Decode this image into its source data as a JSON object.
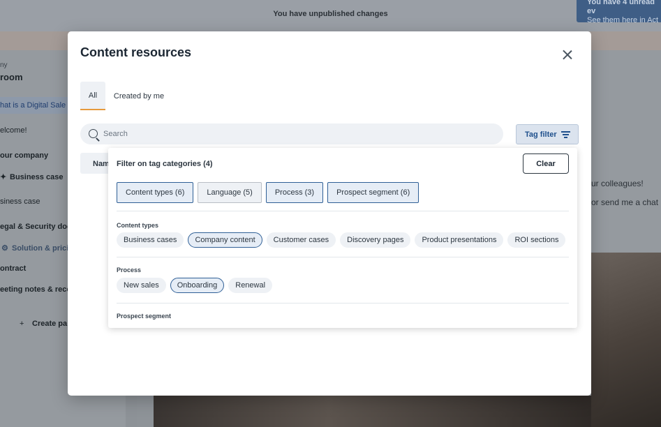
{
  "background": {
    "banner_text": "You have unpublished changes",
    "notification": {
      "line1": "You have 4 unread ev",
      "line2": "See them here in Act"
    },
    "sidebar": {
      "company": "ny",
      "room": "room",
      "items": [
        "hat is a Digital Sale",
        "elcome!",
        "our company",
        "Business case",
        "siness case",
        "egal & Security doc",
        "Solution & pricin",
        "ontract",
        "eeting notes & reco",
        "Create pa"
      ]
    },
    "right_panel": {
      "line1": "ur colleagues!",
      "line2": "or send me a chat"
    }
  },
  "modal": {
    "title": "Content resources",
    "tabs": [
      {
        "label": "All",
        "active": true
      },
      {
        "label": "Created by me",
        "active": false
      }
    ],
    "search": {
      "placeholder": "Search",
      "value": ""
    },
    "tag_filter_label": "Tag filter",
    "name_column_label": "Nam"
  },
  "dropdown": {
    "title": "Filter on tag categories (4)",
    "clear_label": "Clear",
    "categories": [
      {
        "label": "Content types (6)",
        "selected": true
      },
      {
        "label": "Language (5)",
        "selected": false
      },
      {
        "label": "Process (3)",
        "selected": true
      },
      {
        "label": "Prospect segment (6)",
        "selected": true
      }
    ],
    "sections": {
      "content_types": {
        "label": "Content types",
        "tags": [
          {
            "label": "Business cases",
            "selected": false
          },
          {
            "label": "Company content",
            "selected": true
          },
          {
            "label": "Customer cases",
            "selected": false
          },
          {
            "label": "Discovery pages",
            "selected": false
          },
          {
            "label": "Product presentations",
            "selected": false
          },
          {
            "label": "ROI sections",
            "selected": false
          }
        ]
      },
      "process": {
        "label": "Process",
        "tags": [
          {
            "label": "New sales",
            "selected": false
          },
          {
            "label": "Onboarding",
            "selected": true
          },
          {
            "label": "Renewal",
            "selected": false
          }
        ]
      },
      "prospect_segment": {
        "label": "Prospect segment"
      }
    }
  },
  "colors": {
    "accent_orange": "#e69a3c",
    "selected_border": "#2f5f96",
    "tag_filter_text": "#1e4f8c"
  }
}
